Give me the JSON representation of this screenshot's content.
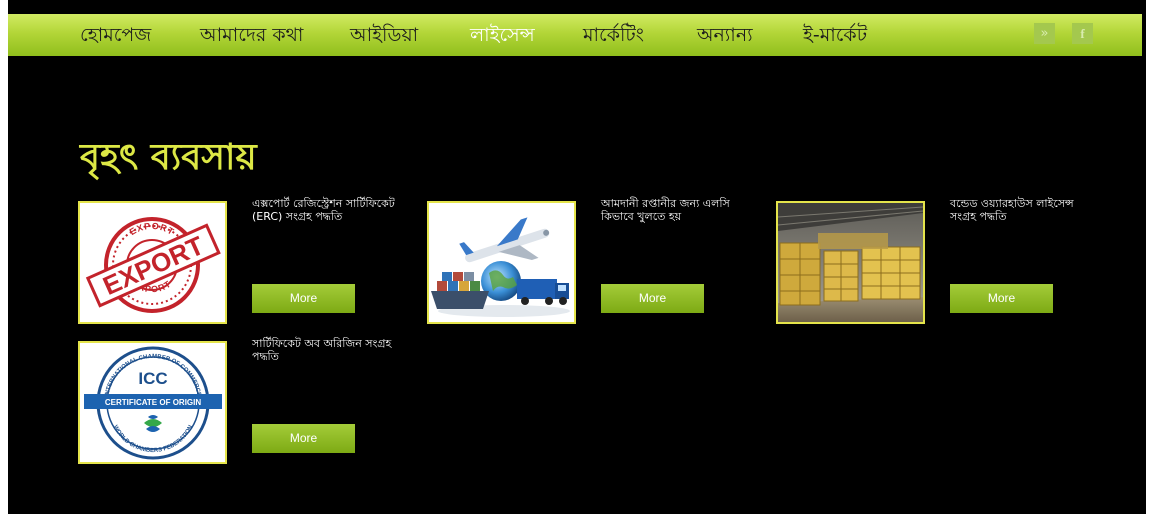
{
  "nav": {
    "items": [
      {
        "label": "হোমপেজ"
      },
      {
        "label": "আমাদের কথা"
      },
      {
        "label": "আইডিয়া"
      },
      {
        "label": "লাইসেন্স"
      },
      {
        "label": "মার্কেটিং"
      },
      {
        "label": "অন্যান্য"
      },
      {
        "label": "ই-মার্কেট"
      }
    ],
    "active_item": "লাইসেন্স",
    "social": {
      "twitter_glyph": "»",
      "facebook_glyph": "f"
    }
  },
  "page": {
    "heading": "বৃহৎ ব্যবসায়"
  },
  "cards": [
    {
      "title": "এক্সপোর্ট রেজিস্ট্রেশন সার্টিফিকেট (ERC) সংগ্রহ পদ্ধতি",
      "button": "More",
      "image_icon": "export-stamp-icon"
    },
    {
      "title": "আমদানী রপ্তানীর জন্য এলসি কিভাবে খুলতে হয়",
      "button": "More",
      "image_icon": "shipping-globe-icon"
    },
    {
      "title": "বন্ডেড ওয়্যারহাউস লাইসেন্স সংগ্রহ পদ্ধতি",
      "button": "More",
      "image_icon": "warehouse-icon"
    },
    {
      "title": "সার্টিফিকেট অব অরিজিন সংগ্রহ পদ্ধতি",
      "button": "More",
      "image_icon": "certificate-seal-icon"
    }
  ],
  "images": {
    "export_stamp": {
      "ring_top": "EXPORT",
      "main": "EXPORT",
      "ring_bottom": "EXPORT"
    },
    "icc_seal": {
      "acronym": "ICC",
      "banner": "CERTIFICATE OF ORIGIN",
      "ring_top": "INTERNATIONAL CHAMBER OF COMMERCE",
      "ring_bottom": "WORLD CHAMBERS FEDERATION"
    }
  },
  "colors": {
    "nav_green_top": "#d1ea62",
    "nav_green_bottom": "#90bf1c",
    "heading_yellow": "#dde845",
    "card_border": "#e4e44b",
    "button_green": "#86b21c",
    "background": "#000000"
  }
}
